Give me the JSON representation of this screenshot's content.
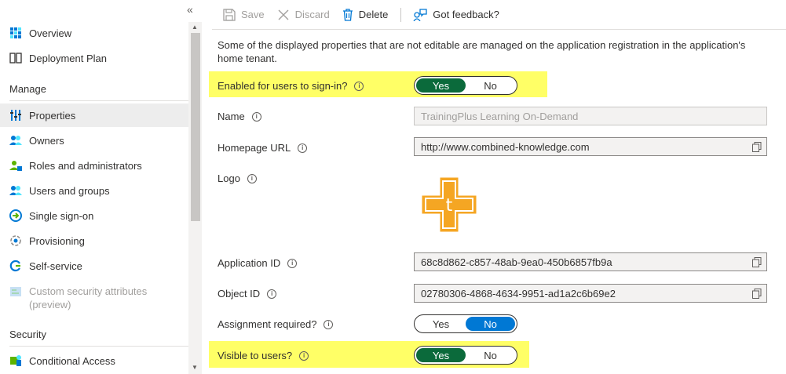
{
  "sidebar": {
    "collapse_label": "«",
    "items": [
      {
        "id": "overview",
        "label": "Overview",
        "icon": "grid-icon"
      },
      {
        "id": "deployment-plan",
        "label": "Deployment Plan",
        "icon": "book-icon"
      }
    ],
    "manage_header": "Manage",
    "manage_items": [
      {
        "id": "properties",
        "label": "Properties",
        "icon": "properties-icon",
        "selected": true
      },
      {
        "id": "owners",
        "label": "Owners",
        "icon": "people-icon"
      },
      {
        "id": "roles",
        "label": "Roles and administrators",
        "icon": "person-badge-icon"
      },
      {
        "id": "users-groups",
        "label": "Users and groups",
        "icon": "people-icon"
      },
      {
        "id": "sso",
        "label": "Single sign-on",
        "icon": "sign-in-icon"
      },
      {
        "id": "provisioning",
        "label": "Provisioning",
        "icon": "provisioning-icon"
      },
      {
        "id": "self-service",
        "label": "Self-service",
        "icon": "self-service-icon"
      },
      {
        "id": "custom-security",
        "label": "Custom security attributes (preview)",
        "icon": "custom-attributes-icon",
        "disabled": true
      }
    ],
    "security_header": "Security",
    "security_items": [
      {
        "id": "conditional-access",
        "label": "Conditional Access",
        "icon": "conditional-access-icon"
      }
    ]
  },
  "toolbar": {
    "save_label": "Save",
    "discard_label": "Discard",
    "delete_label": "Delete",
    "feedback_label": "Got feedback?"
  },
  "main": {
    "info_text": "Some of the displayed properties that are not editable are managed on the application registration in the application's home tenant.",
    "enabled_label": "Enabled for users to sign-in?",
    "enabled_yes": "Yes",
    "enabled_no": "No",
    "enabled_value": "Yes",
    "name_label": "Name",
    "name_value": "TrainingPlus Learning On-Demand",
    "homepage_label": "Homepage URL",
    "homepage_value": "http://www.combined-knowledge.com",
    "logo_label": "Logo",
    "logo_letter": "t",
    "app_id_label": "Application ID",
    "app_id_value": "68c8d862-c857-48ab-9ea0-450b6857fb9a",
    "object_id_label": "Object ID",
    "object_id_value": "02780306-4868-4634-9951-ad1a2c6b69e2",
    "assignment_label": "Assignment required?",
    "assignment_yes": "Yes",
    "assignment_no": "No",
    "assignment_value": "No",
    "visible_label": "Visible to users?",
    "visible_yes": "Yes",
    "visible_no": "No",
    "visible_value": "Yes"
  },
  "colors": {
    "toggle_on_green": "#0b6a3b",
    "toggle_on_blue": "#0078d4",
    "highlight": "#ffff66",
    "logo_orange": "#f5a623"
  }
}
